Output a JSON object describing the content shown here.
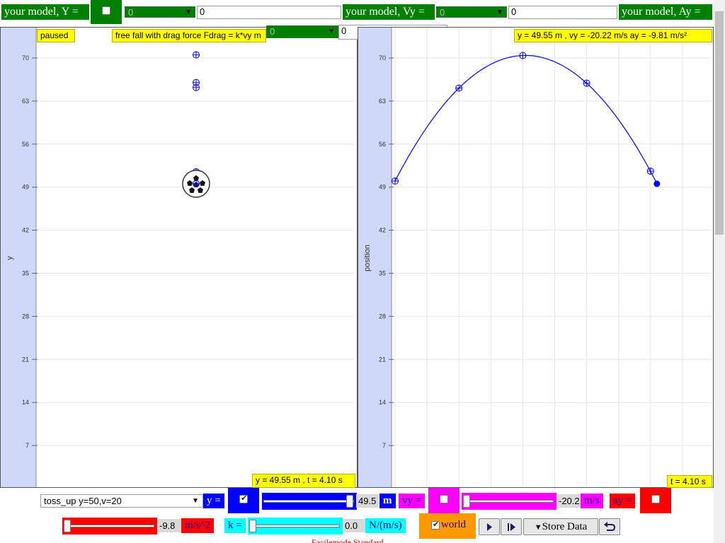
{
  "top": {
    "model_y_label": "your model, Y =",
    "model_y_select": "0",
    "model_y_input": "0",
    "model_vy_label": "your model, Vy =",
    "model_vy_select": "0",
    "model_vy_input": "0",
    "model_ay_label": "your model, Ay =",
    "model_ay_select": "0",
    "model_ay_input": "0"
  },
  "left_plot": {
    "status": "paused",
    "title": "free fall with drag force Fdrag = k*vy m",
    "ylabel": "y",
    "readout": "y = 49.55 m , t = 4.10 s",
    "y_ticks": [
      "70",
      "63",
      "56",
      "49",
      "42",
      "35",
      "28",
      "21",
      "14",
      "7"
    ],
    "ball_y": 49.55,
    "trace_y": [
      70.5,
      66.0,
      65.2,
      51.5,
      50.0
    ]
  },
  "chart_data": {
    "type": "line",
    "ylabel": "position",
    "ylim": [
      0,
      75
    ],
    "y_ticks": [
      7,
      14,
      21,
      28,
      35,
      42,
      49,
      56,
      63,
      70
    ],
    "readout": "y = 49.55 m , vy = -20.22 m/s ay = -9.81 m/s²",
    "time_readout": "t = 4.10 s",
    "grid": true,
    "series": [
      {
        "x": [
          0,
          1.0,
          2.0,
          3.0,
          4.0,
          4.1
        ],
        "y": [
          50.0,
          65.1,
          70.4,
          65.9,
          51.6,
          49.55
        ]
      }
    ],
    "line_color": "#0000ff"
  },
  "controls": {
    "scenario": "toss_up y=50,v=20",
    "y_label": "y =",
    "y_value": "49.5",
    "y_unit": "m",
    "y_fill": 0.99,
    "vy_label": "vy =",
    "vy_value": "-20.2",
    "vy_unit": "m/s",
    "vy_fill": 0.0,
    "ay_label": "ay =",
    "ay_value": "-9.8",
    "ay_unit": "m/s^2",
    "ay_fill": 0.0,
    "k_label": "k =",
    "k_value": "0.0",
    "k_unit": "N/(m/s)",
    "k_fill": 0.0,
    "world_label": "world",
    "store_data_label": "Store Data",
    "footer_text": "Facilemode Standard"
  },
  "colors": {
    "green": "#008000",
    "yellow": "#ffff00",
    "blue": "#0000ff",
    "magenta": "#ff00ff",
    "red": "#ff0000",
    "cyan": "#00ffff",
    "orange": "#ff9900",
    "axis_band": "#d0d8f8"
  },
  "icons": [
    "checkbox-icon",
    "dropdown-arrow-icon",
    "play-icon",
    "step-icon",
    "dropdown-triangle-icon",
    "reset-icon",
    "soccer-ball-icon",
    "crosshair-marker-icon"
  ]
}
